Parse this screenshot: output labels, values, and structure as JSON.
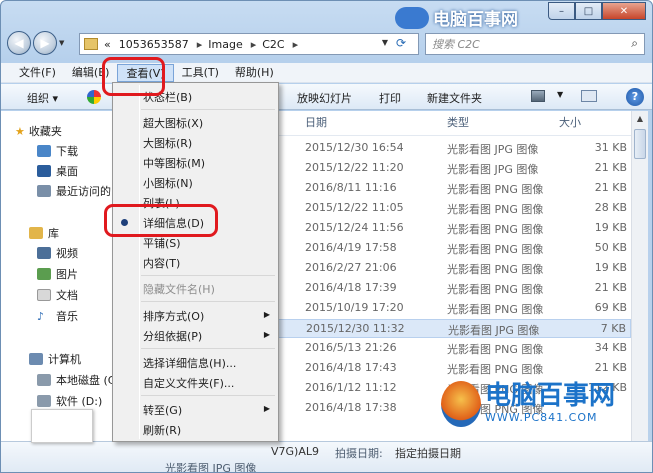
{
  "window": {
    "caption_buttons": [
      "–",
      "□",
      "✕"
    ]
  },
  "watermark_top": "电脑百事网",
  "watermark_bottom": {
    "title": "电脑百事网",
    "url": "WWW.PC841.COM"
  },
  "address": {
    "prefix": "«",
    "parts": [
      "1053653587",
      "Image",
      "C2C"
    ],
    "separator": "▸"
  },
  "search": {
    "placeholder": "搜索 C2C"
  },
  "menubar": [
    "文件(F)",
    "编辑(E)",
    "查看(V)",
    "工具(T)",
    "帮助(H)"
  ],
  "toolbar": {
    "organize": "组织 ▾",
    "slideshow": "放映幻灯片",
    "print": "打印",
    "new_folder": "新建文件夹"
  },
  "nav_pane": {
    "favorites": "收藏夹",
    "downloads": "下载",
    "desktop": "桌面",
    "recent": "最近访问的",
    "libraries": "库",
    "videos": "视频",
    "pictures": "图片",
    "documents": "文档",
    "music": "音乐",
    "computer": "计算机",
    "local_c": "本地磁盘 (C",
    "soft_d": "软件 (D:)"
  },
  "columns": {
    "date": "日期",
    "type": "类型",
    "size": "大小"
  },
  "files": [
    {
      "date": "2015/12/30 16:54",
      "type": "光影看图 JPG 图像",
      "size": "31 KB"
    },
    {
      "date": "2015/12/22 11:20",
      "type": "光影看图 JPG 图像",
      "size": "21 KB"
    },
    {
      "date": "2016/8/11 11:16",
      "type": "光影看图 PNG 图像",
      "size": "21 KB"
    },
    {
      "date": "2015/12/22 11:05",
      "type": "光影看图 PNG 图像",
      "size": "28 KB"
    },
    {
      "date": "2015/12/24 11:56",
      "type": "光影看图 PNG 图像",
      "size": "19 KB"
    },
    {
      "date": "2016/4/19 17:58",
      "type": "光影看图 PNG 图像",
      "size": "50 KB"
    },
    {
      "date": "2016/2/27 21:06",
      "type": "光影看图 PNG 图像",
      "size": "19 KB"
    },
    {
      "date": "2016/4/18 17:39",
      "type": "光影看图 PNG 图像",
      "size": "21 KB"
    },
    {
      "date": "2015/10/19 17:20",
      "type": "光影看图 PNG 图像",
      "size": "69 KB"
    },
    {
      "date": "2015/12/30 11:32",
      "type": "光影看图 JPG 图像",
      "size": "7 KB"
    },
    {
      "date": "2016/5/13 21:26",
      "type": "光影看图 PNG 图像",
      "size": "34 KB"
    },
    {
      "date": "2016/4/18 17:43",
      "type": "光影看图 PNG 图像",
      "size": "21 KB"
    },
    {
      "date": "2016/1/12 11:12",
      "type": "光影看图 PNG 图像",
      "size": "112 KB"
    },
    {
      "date": "2016/4/18 17:38",
      "type": "光影看图 PNG 图像",
      "size": ""
    }
  ],
  "details": {
    "type": "光影看图 JPG 图像",
    "name": "V7G)AL9",
    "label": "拍摄日期:",
    "value": "指定拍摄日期"
  },
  "view_menu": {
    "status_bar": "状态栏(B)",
    "xl_icons": "超大图标(X)",
    "l_icons": "大图标(R)",
    "m_icons": "中等图标(M)",
    "s_icons": "小图标(N)",
    "list": "列表(L)",
    "details": "详细信息(D)",
    "tiles": "平铺(S)",
    "content": "内容(T)",
    "hide_ext": "隐藏文件名(H)",
    "sort_by": "排序方式(O)",
    "group_by": "分组依据(P)",
    "choose_details": "选择详细信息(H)...",
    "customize": "自定义文件夹(F)...",
    "go_to": "转至(G)",
    "refresh": "刷新(R)"
  }
}
